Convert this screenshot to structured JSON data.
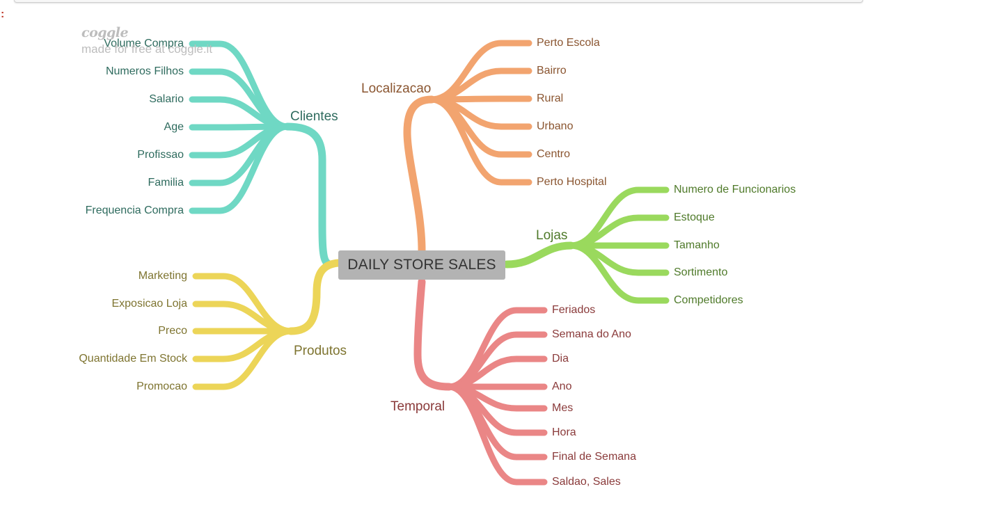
{
  "watermark": {
    "logo": "coggle",
    "text": "made for free at coggle.it"
  },
  "prompt_mark": ":",
  "center": {
    "label": "DAILY STORE SALES"
  },
  "branches": [
    {
      "key": "clientes",
      "label": "Clientes",
      "line_color": "#6fd8c4",
      "text_color": "#2e6b5e",
      "items": [
        "Volume Compra",
        "Numeros Filhos",
        "Salario",
        "Age",
        "Profissao",
        "Familia",
        "Frequencia Compra"
      ]
    },
    {
      "key": "produtos",
      "label": "Produtos",
      "line_color": "#ecd558",
      "text_color": "#7e7430",
      "items": [
        "Marketing",
        "Exposicao Loja",
        "Preco",
        "Quantidade Em Stock",
        "Promocao"
      ]
    },
    {
      "key": "localizacao",
      "label": "Localizacao",
      "line_color": "#f2a46f",
      "text_color": "#8a5530",
      "items": [
        "Perto Escola",
        "Bairro",
        "Rural",
        "Urbano",
        "Centro",
        "Perto Hospital"
      ]
    },
    {
      "key": "lojas",
      "label": "Lojas",
      "line_color": "#9ad95d",
      "text_color": "#4f7a2a",
      "items": [
        "Numero de Funcionarios",
        "Estoque",
        "Tamanho",
        "Sortimento",
        "Competidores"
      ]
    },
    {
      "key": "temporal",
      "label": "Temporal",
      "line_color": "#ea8686",
      "text_color": "#8a3a3a",
      "items": [
        "Feriados",
        "Semana do Ano",
        "Dia",
        "Ano",
        "Mes",
        "Hora",
        "Final de Semana",
        "Saldao, Sales"
      ]
    }
  ]
}
